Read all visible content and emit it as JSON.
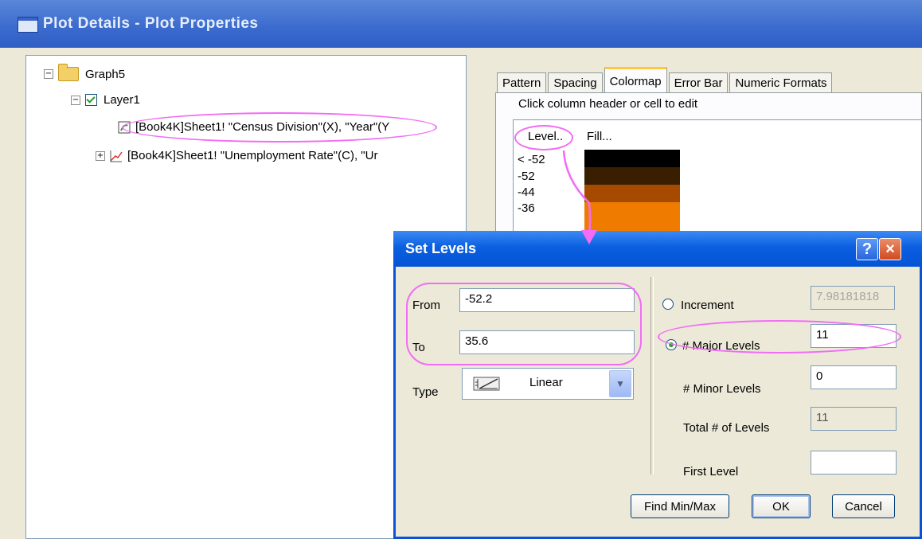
{
  "window": {
    "title": "Plot Details - Plot Properties"
  },
  "tree": {
    "root": "Graph5",
    "layer": "Layer1",
    "plots": [
      "[Book4K]Sheet1! \"Census Division\"(X), \"Year\"(Y",
      "[Book4K]Sheet1! \"Unemployment Rate\"(C), \"Ur"
    ]
  },
  "tabs": [
    "Pattern",
    "Spacing",
    "Colormap",
    "Error Bar",
    "Numeric Formats"
  ],
  "colormap": {
    "hint": "Click column header or cell to edit",
    "headers": {
      "level": "Level..",
      "fill": "Fill..."
    },
    "rows": [
      {
        "level": "< -52",
        "color": "#000000"
      },
      {
        "level": "-52",
        "color": "#3a1e00"
      },
      {
        "level": "-44",
        "color": "#a64a00"
      },
      {
        "level": "-36",
        "color": "#ef7c00"
      }
    ]
  },
  "set_levels": {
    "title": "Set Levels",
    "from_label": "From",
    "from_value": "-52.2",
    "to_label": "To",
    "to_value": "35.6",
    "type_label": "Type",
    "type_value": "Linear",
    "increment_label": "Increment",
    "increment_value": "7.98181818",
    "major_label": "# Major Levels",
    "major_value": "11",
    "minor_label": "# Minor Levels",
    "minor_value": "0",
    "total_label": "Total # of Levels",
    "total_value": "11",
    "first_label": "First Level",
    "first_value": "",
    "buttons": {
      "find": "Find Min/Max",
      "ok": "OK",
      "cancel": "Cancel"
    },
    "help": "?",
    "close": "×"
  },
  "colors": {
    "annotation": "#f26cf5",
    "xp_blue": "#0453d6",
    "dialog_bg": "#ece9d8"
  }
}
